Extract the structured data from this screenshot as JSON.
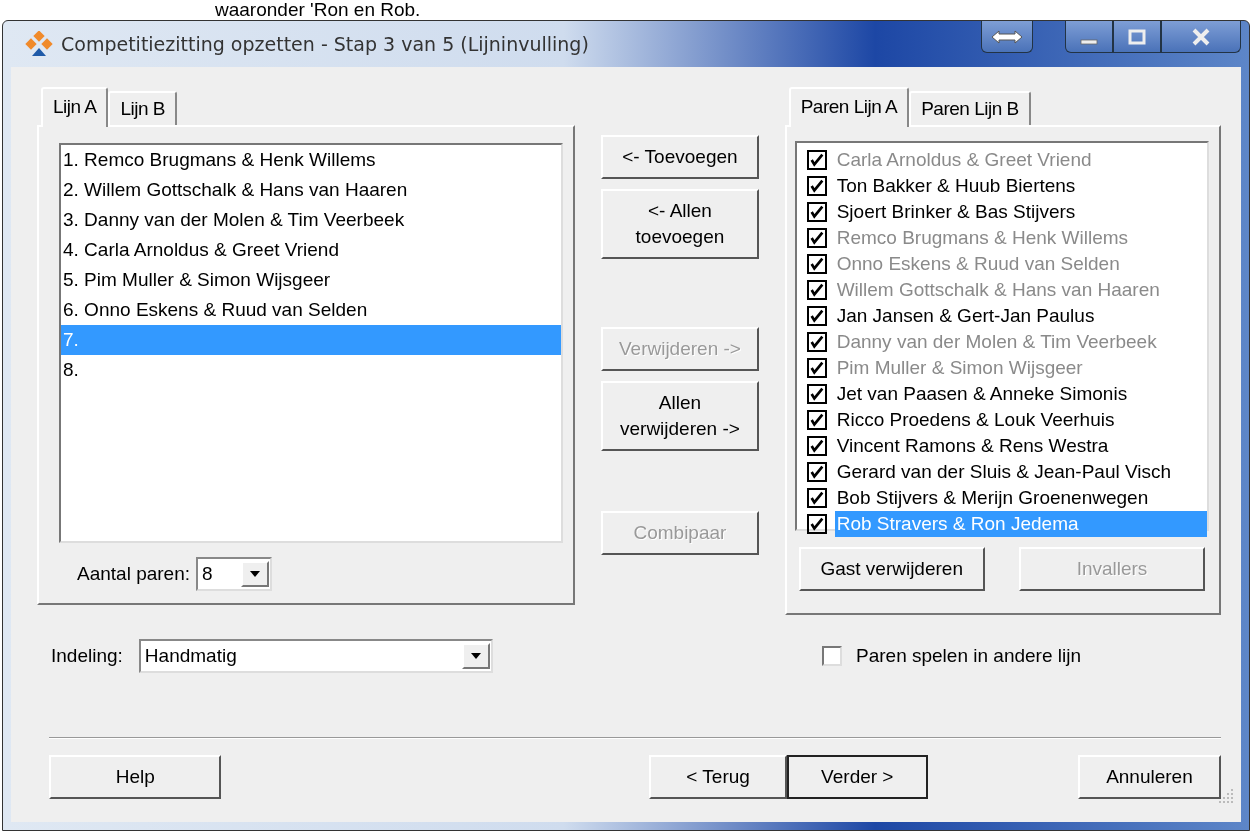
{
  "caption": "waaronder 'Ron en Rob.",
  "window": {
    "title": "Competitiezitting opzetten - Stap 3 van 5 (Lijninvulling)"
  },
  "line_tabs": [
    {
      "label": "Lijn A",
      "selected": true
    },
    {
      "label": "Lijn B",
      "selected": false
    }
  ],
  "line_list": [
    {
      "label": "1. Remco Brugmans & Henk Willems",
      "selected": false
    },
    {
      "label": "2. Willem Gottschalk & Hans van Haaren",
      "selected": false
    },
    {
      "label": "3. Danny van der Molen & Tim Veerbeek",
      "selected": false
    },
    {
      "label": "4. Carla Arnoldus & Greet Vriend",
      "selected": false
    },
    {
      "label": "5. Pim Muller & Simon Wijsgeer",
      "selected": false
    },
    {
      "label": "6. Onno Eskens & Ruud van Selden",
      "selected": false
    },
    {
      "label": "7.",
      "selected": true
    },
    {
      "label": "8.",
      "selected": false
    }
  ],
  "pair_count": {
    "label": "Aantal paren:",
    "value": "8"
  },
  "middle_buttons": [
    {
      "label": "<- Toevoegen",
      "disabled": false
    },
    {
      "label": "<- Allen toevoegen",
      "disabled": false
    },
    {
      "label": "Verwijderen ->",
      "disabled": true
    },
    {
      "label": "Allen verwijderen ->",
      "disabled": false
    },
    {
      "label": "Combipaar",
      "disabled": true
    }
  ],
  "pair_tabs": [
    {
      "label": "Paren Lijn A",
      "selected": true
    },
    {
      "label": "Paren Lijn B",
      "selected": false
    }
  ],
  "pair_list": [
    {
      "label": "Carla Arnoldus & Greet Vriend",
      "checked": true,
      "assigned": true,
      "selected": false
    },
    {
      "label": "Ton Bakker & Huub Biertens",
      "checked": true,
      "assigned": false,
      "selected": false
    },
    {
      "label": "Sjoert Brinker & Bas Stijvers",
      "checked": true,
      "assigned": false,
      "selected": false
    },
    {
      "label": "Remco Brugmans & Henk Willems",
      "checked": true,
      "assigned": true,
      "selected": false
    },
    {
      "label": "Onno Eskens & Ruud van Selden",
      "checked": true,
      "assigned": true,
      "selected": false
    },
    {
      "label": "Willem Gottschalk & Hans van Haaren",
      "checked": true,
      "assigned": true,
      "selected": false
    },
    {
      "label": "Jan Jansen & Gert-Jan Paulus",
      "checked": true,
      "assigned": false,
      "selected": false
    },
    {
      "label": "Danny van der Molen & Tim Veerbeek",
      "checked": true,
      "assigned": true,
      "selected": false
    },
    {
      "label": "Pim Muller & Simon Wijsgeer",
      "checked": true,
      "assigned": true,
      "selected": false
    },
    {
      "label": "Jet van Paasen & Anneke Simonis",
      "checked": true,
      "assigned": false,
      "selected": false
    },
    {
      "label": "Ricco Proedens & Louk Veerhuis",
      "checked": true,
      "assigned": false,
      "selected": false
    },
    {
      "label": "Vincent Ramons & Rens Westra",
      "checked": true,
      "assigned": false,
      "selected": false
    },
    {
      "label": "Gerard van der Sluis & Jean-Paul Visch",
      "checked": true,
      "assigned": false,
      "selected": false
    },
    {
      "label": "Bob Stijvers & Merijn Groenenwegen",
      "checked": true,
      "assigned": false,
      "selected": false
    },
    {
      "label": "Rob Stravers & Ron Jedema",
      "checked": true,
      "assigned": false,
      "selected": true
    }
  ],
  "pair_buttons": [
    {
      "label": "Gast verwijderen",
      "disabled": false
    },
    {
      "label": "Invallers",
      "disabled": true
    }
  ],
  "division": {
    "label": "Indeling:",
    "value": "Handmatig"
  },
  "other_line": {
    "label": "Paren spelen in andere lijn",
    "checked": false
  },
  "footer_buttons": [
    {
      "label": "Help",
      "default": false
    },
    {
      "label": "< Terug",
      "default": false
    },
    {
      "label": "Verder >",
      "default": true
    },
    {
      "label": "Annuleren",
      "default": false
    }
  ]
}
